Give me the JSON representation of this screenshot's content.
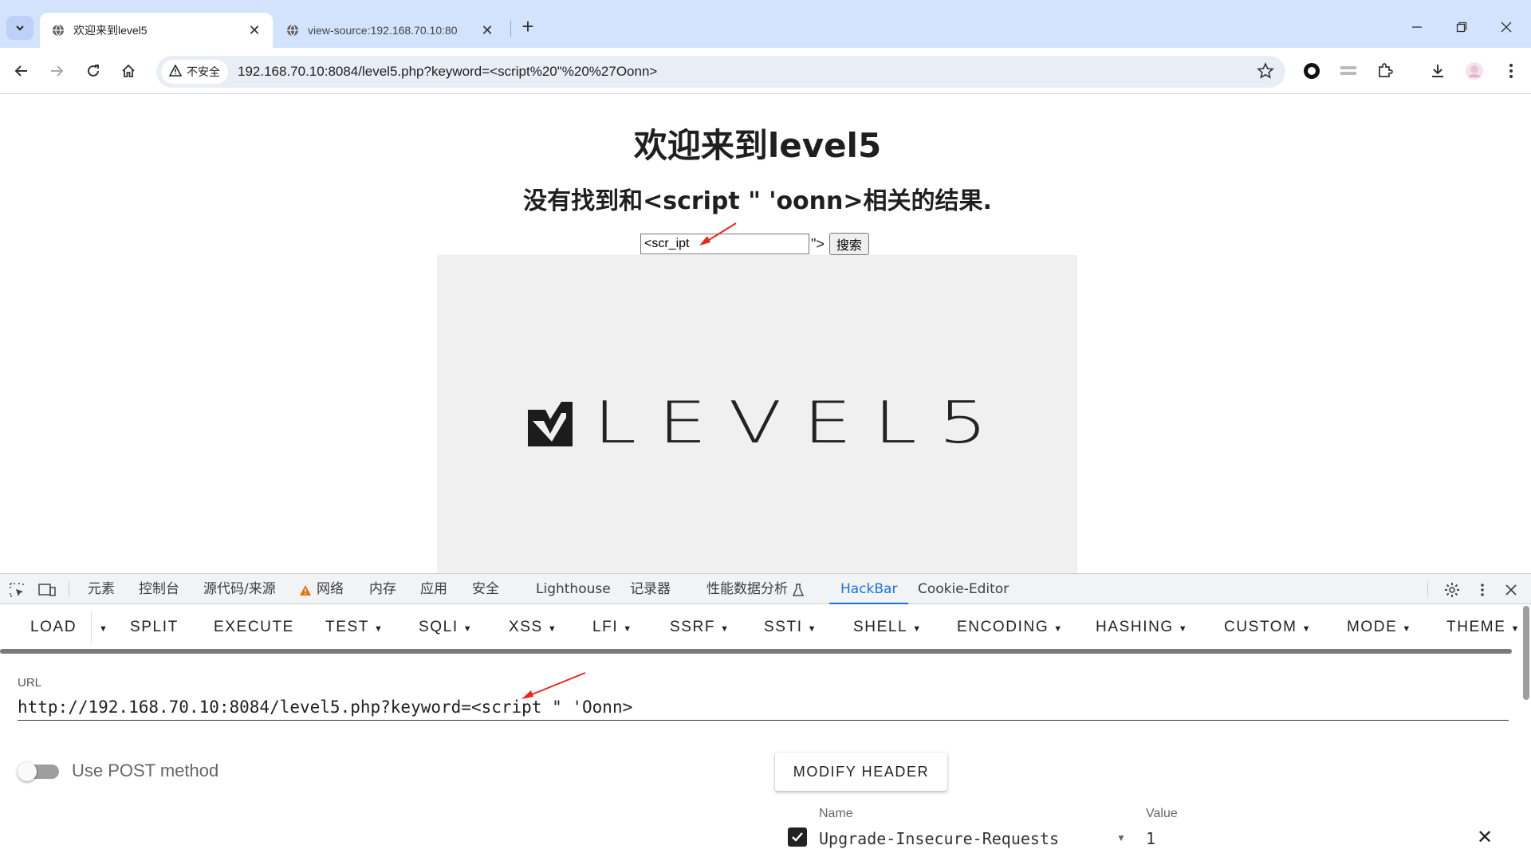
{
  "browser": {
    "tabs": [
      {
        "title": "欢迎来到level5",
        "active": true
      },
      {
        "title": "view-source:192.168.70.10:80",
        "active": false
      }
    ],
    "address": {
      "security_label": "不安全",
      "url": "192.168.70.10:8084/level5.php?keyword=<script%20\"%20%27Oonn>"
    }
  },
  "page": {
    "title": "欢迎来到level5",
    "result_text": "没有找到和<script \" 'oonn>相关的结果.",
    "search_value": "<scr_ipt",
    "after_input": "\">",
    "search_button": "搜索",
    "logo_text": "LEVEL5"
  },
  "devtools": {
    "tabs": [
      "元素",
      "控制台",
      "源代码/来源",
      "网络",
      "内存",
      "应用",
      "安全",
      "Lighthouse",
      "记录器",
      "性能数据分析",
      "HackBar",
      "Cookie-Editor"
    ],
    "active_tab": "HackBar"
  },
  "hackbar": {
    "menu": [
      {
        "label": "LOAD"
      },
      {
        "label": "SPLIT"
      },
      {
        "label": "EXECUTE"
      },
      {
        "label": "TEST"
      },
      {
        "label": "SQLI"
      },
      {
        "label": "XSS"
      },
      {
        "label": "LFI"
      },
      {
        "label": "SSRF"
      },
      {
        "label": "SSTI"
      },
      {
        "label": "SHELL"
      },
      {
        "label": "ENCODING"
      },
      {
        "label": "HASHING"
      },
      {
        "label": "CUSTOM"
      },
      {
        "label": "MODE"
      },
      {
        "label": "THEME"
      }
    ],
    "url_label": "URL",
    "url_value": "http://192.168.70.10:8084/level5.php?keyword=<script \" 'Oonn>",
    "post_label": "Use POST method",
    "post_enabled": false,
    "modify_header_label": "MODIFY HEADER",
    "header_name_label": "Name",
    "header_value_label": "Value",
    "header_name": "Upgrade-Insecure-Requests",
    "header_value": "1",
    "header_enabled": true
  },
  "colors": {
    "tabstrip_bg": "#d3e3fd",
    "accent": "#1a73e8",
    "annotation_arrow": "#e8261d"
  }
}
